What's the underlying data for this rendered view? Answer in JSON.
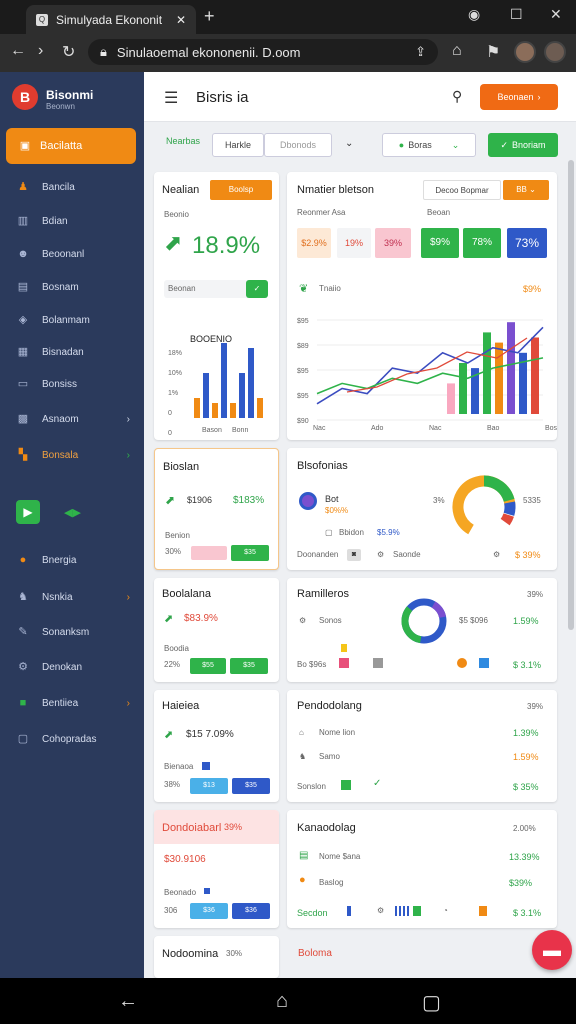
{
  "browser": {
    "tab_title": "Simulyada Ekononit",
    "url": "Sinulaoemal ekononenii. D.oom"
  },
  "sidebar": {
    "brand_name": "Bisonmi",
    "brand_sub": "Beonwn",
    "active_item": "Bacilatta",
    "items": [
      {
        "label": "Bancila",
        "icon": "people-icon"
      },
      {
        "label": "Bdian",
        "icon": "book-icon"
      },
      {
        "label": "Beoonanl",
        "icon": "group-icon"
      },
      {
        "label": "Bosnam",
        "icon": "document-icon"
      },
      {
        "label": "Bolanmam",
        "icon": "shield-icon"
      },
      {
        "label": "Bisnadan",
        "icon": "calendar-icon"
      },
      {
        "label": "Bonsiss",
        "icon": "briefcase-icon"
      },
      {
        "label": "Asnaom",
        "icon": "grid-icon"
      },
      {
        "label": "Bonsala",
        "icon": "map-icon"
      },
      {
        "label": "Bnergia",
        "icon": "coin-icon"
      },
      {
        "label": "Nsnkia",
        "icon": "person-icon"
      },
      {
        "label": "Sonanksm",
        "icon": "edit-icon"
      },
      {
        "label": "Denokan",
        "icon": "settings-icon"
      },
      {
        "label": "Bentiiea",
        "icon": "tablet-icon"
      },
      {
        "label": "Cohopradas",
        "icon": "box-icon"
      }
    ]
  },
  "header": {
    "title": "Bisris  ia",
    "action": "Beonaen"
  },
  "filters": {
    "label": "Nearbas",
    "seg1": "Harkle",
    "seg2": "Dbonods",
    "select": "Boras",
    "button": "Bnoriam"
  },
  "cards": {
    "c1": {
      "title": "Nealian",
      "badge": "Boolsp",
      "sub": "Beonio",
      "value": "18.9%",
      "row_label": "Beonan",
      "chart_label": "BOOENIO",
      "ticks": [
        "18%",
        "10%",
        "1%",
        "0",
        "0"
      ],
      "x": [
        "Bason",
        "Bonn"
      ]
    },
    "c2": {
      "title": "Nmatier bletson",
      "dropdown": "Decoo Bopmar",
      "badge": "BB",
      "sub1": "Reonmer Asa",
      "sub2": "Beoan",
      "chips": [
        "$2.9%",
        "19%",
        "39%",
        "$9%",
        "78%",
        "73%"
      ],
      "legend": "Tnaiio",
      "legend_val": "$9%",
      "ticks": [
        "$95",
        "$89",
        "$95",
        "$95",
        "$90"
      ],
      "x": [
        "Nac",
        "Ado",
        "Nac",
        "Bao",
        "Bos"
      ]
    },
    "c3": {
      "title": "Bioslan",
      "v1": "$1906",
      "v2": "$183%",
      "label": "Benion",
      "pct": "30%",
      "chip": "$35"
    },
    "c4": {
      "title": "Blsofonias",
      "item": "Bot",
      "item_sub": "$0%%",
      "left_pct": "3%",
      "right_val": "5335",
      "row1": "Bbidon",
      "row1_val": "$5.9%",
      "foot1": "Doonanden",
      "foot2": "Saonde",
      "foot3": "$ 39%"
    },
    "c5": {
      "title": "Boolalana",
      "value": "$83.9%",
      "label": "Boodia",
      "pct": "22%",
      "chip1": "$55",
      "chip2": "$35"
    },
    "c6": {
      "title": "Ramilleros",
      "right": "39%",
      "row1": "Sonos",
      "row1_mid": "$5 $096",
      "row1_val": "1.59%",
      "row2": "Bo $96s",
      "row2_val": "$ 3.1%"
    },
    "c7": {
      "title": "Haieiea",
      "value": "$15 7.09%",
      "label": "Bienaoa",
      "pct": "38%",
      "chip1": "$13",
      "chip2": "$35"
    },
    "c8": {
      "title": "Pendodolang",
      "right": "39%",
      "row1": "Nome lion",
      "row1_val": "1.39%",
      "row2": "Samo",
      "row2_val": "1.59%",
      "foot": "Sonslon",
      "foot_val": "$ 35%"
    },
    "c9": {
      "title": "Dondoiabarl",
      "badge": "39%",
      "value": "$30.9106",
      "label": "Beonado",
      "pct": "306",
      "chip1": "$36",
      "chip2": "$36"
    },
    "c10": {
      "title": "Kanaodolag",
      "right": "2.00%",
      "row1": "Nome $ana",
      "row1_val": "13.39%",
      "row2": "Baslog",
      "row2_val": "$39%",
      "foot": "Secdon",
      "foot_val": "$ 3.1%"
    },
    "c11": {
      "title": "Nodoomina",
      "pct": "30%"
    },
    "c12": {
      "title": "Boloma"
    }
  },
  "colors": {
    "accent": "#f08a14",
    "sidebar": "#2b3a5c",
    "green": "#2fb34a",
    "blue": "#2f59c8"
  },
  "chart_data": [
    {
      "type": "bar",
      "title": "BOOENIO",
      "categories": [
        "1",
        "2",
        "3",
        "4",
        "5",
        "6",
        "7",
        "8"
      ],
      "series": [
        {
          "values": [
            4,
            9,
            3,
            15,
            3,
            9,
            14,
            4
          ]
        }
      ],
      "ylim": [
        0,
        18
      ]
    },
    {
      "type": "line",
      "x": [
        "Nac",
        "Ado",
        "Nac",
        "Bao",
        "Bos"
      ],
      "series": [
        {
          "values": [
            2,
            5,
            4,
            9,
            8,
            12,
            10,
            13,
            12,
            17
          ]
        },
        {
          "values": [
            4,
            6,
            5,
            7,
            6,
            8,
            7,
            9,
            10,
            11
          ]
        }
      ],
      "bars": [
        6,
        10,
        9,
        16,
        14,
        18,
        12,
        15
      ],
      "ylim": [
        0,
        20
      ]
    }
  ]
}
